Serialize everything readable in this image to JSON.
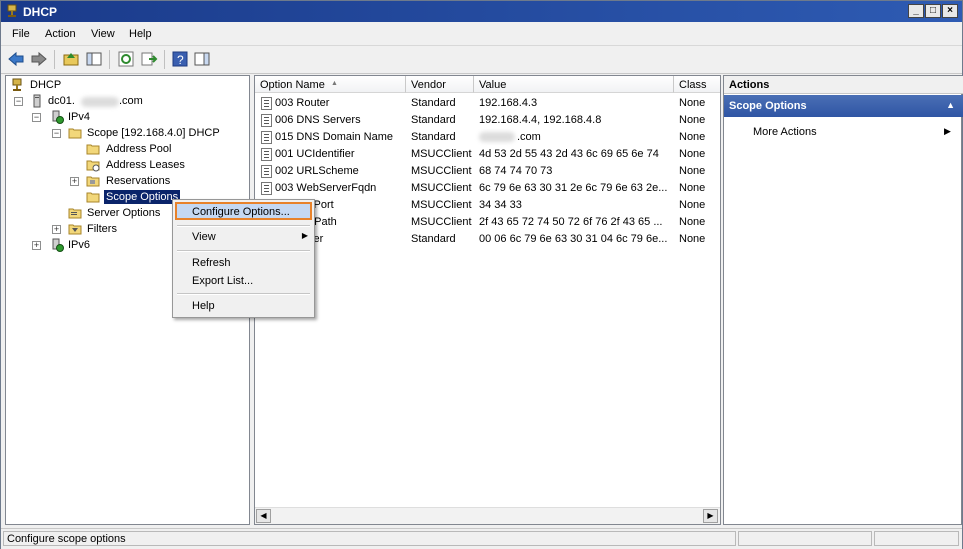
{
  "window": {
    "title": "DHCP"
  },
  "menu": [
    "File",
    "Action",
    "View",
    "Help"
  ],
  "tree": {
    "root": "DHCP",
    "server": "dc01.",
    "server_suffix": ".com",
    "ipv4": "IPv4",
    "scope": "Scope [192.168.4.0] DHCP",
    "address_pool": "Address Pool",
    "address_leases": "Address Leases",
    "reservations": "Reservations",
    "scope_options": "Scope Options",
    "server_options": "Server Options",
    "filters": "Filters",
    "ipv6": "IPv6"
  },
  "list": {
    "columns": [
      "Option Name",
      "Vendor",
      "Value",
      "Class"
    ],
    "rows": [
      {
        "name": "003 Router",
        "vendor": "Standard",
        "value": "192.168.4.3",
        "class": "None"
      },
      {
        "name": "006 DNS Servers",
        "vendor": "Standard",
        "value": "192.168.4.4, 192.168.4.8",
        "class": "None"
      },
      {
        "name": "015 DNS Domain Name",
        "vendor": "Standard",
        "value": ".com",
        "class": "None"
      },
      {
        "name": "001 UCIdentifier",
        "vendor": "MSUCClient",
        "value": "4d 53 2d 55 43 2d 43 6c 69 65 6e 74",
        "class": "None"
      },
      {
        "name": "002 URLScheme",
        "vendor": "MSUCClient",
        "value": "68 74 74 70 73",
        "class": "None"
      },
      {
        "name": "003 WebServerFqdn",
        "vendor": "MSUCClient",
        "value": "6c 79 6e 63 30 31 2e 6c 79 6e 63 2e...",
        "class": "None"
      },
      {
        "name": "bServerPort",
        "vendor": "MSUCClient",
        "value": "34 34 33",
        "class": "None"
      },
      {
        "name": "ProvRelPath",
        "vendor": "MSUCClient",
        "value": "2f 43 65 72 74 50 72 6f 76 2f 43 65 ...",
        "class": "None"
      },
      {
        "name": "SipServer",
        "vendor": "Standard",
        "value": "00 06 6c 79 6e 63 30 31 04 6c 79 6e...",
        "class": "None"
      }
    ]
  },
  "actions": {
    "header": "Actions",
    "selected": "Scope Options",
    "more": "More Actions"
  },
  "context_menu": {
    "configure": "Configure Options...",
    "view": "View",
    "refresh": "Refresh",
    "export": "Export List...",
    "help": "Help"
  },
  "status": {
    "text": "Configure scope options"
  },
  "colors": {
    "accent": "#2f55a4",
    "highlight": "#0a246a",
    "focus_border": "#e8822a"
  }
}
